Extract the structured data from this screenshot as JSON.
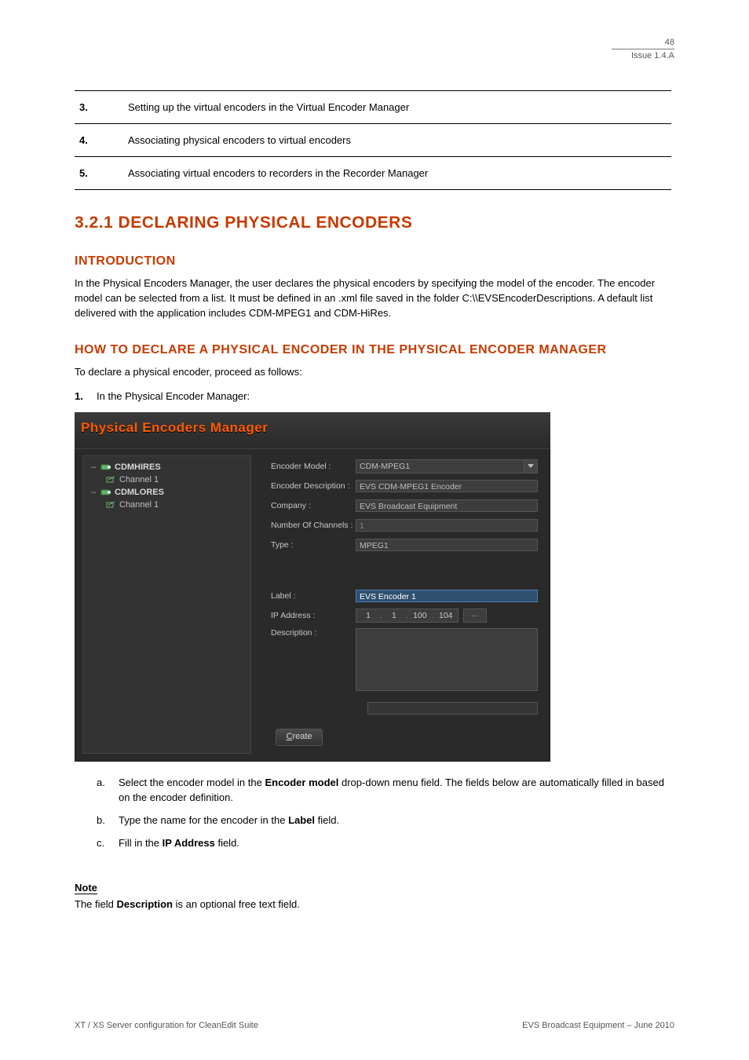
{
  "header": {
    "page_no": "48",
    "issue": "Issue 1.4.A"
  },
  "stage_rows": [
    {
      "n": "3.",
      "t": "Setting up the virtual encoders in the Virtual Encoder Manager"
    },
    {
      "n": "4.",
      "t": "Associating physical encoders to virtual encoders"
    },
    {
      "n": "5.",
      "t": "Associating virtual encoders to recorders in the Recorder Manager"
    }
  ],
  "section": "3.2.1 DECLARING PHYSICAL ENCODERS",
  "intro": {
    "heading": "INTRODUCTION",
    "paragraph": "In the Physical Encoders Manager, the user declares the physical encoders by specifying the model of the encoder. The encoder model can be selected from a list. It must be defined in an .xml file saved in the folder C:\\\\EVSEncoderDescriptions. A default list delivered with the application includes CDM-MPEG1 and CDM-HiRes."
  },
  "howto": {
    "heading": "HOW TO DECLARE A PHYSICAL ENCODER IN THE PHYSICAL ENCODER MANAGER",
    "pre": "To declare a physical encoder, proceed as follows:",
    "step1_n": "1.",
    "step1_t": "In the Physical Encoder Manager:"
  },
  "screenshot": {
    "title": "Physical Encoders Manager",
    "tree": [
      {
        "type": "enc",
        "label": "CDMHIRES"
      },
      {
        "type": "ch",
        "label": "Channel 1"
      },
      {
        "type": "enc",
        "label": "CDMLORES"
      },
      {
        "type": "ch",
        "label": "Channel 1"
      }
    ],
    "form": {
      "rows": [
        {
          "label": "Encoder Model :",
          "kind": "select",
          "value": "CDM-MPEG1"
        },
        {
          "label": "Encoder Description :",
          "kind": "input",
          "value": "EVS CDM-MPEG1 Encoder"
        },
        {
          "label": "Company :",
          "kind": "input",
          "value": "EVS Broadcast Equipment"
        },
        {
          "label": "Number Of Channels :",
          "kind": "input",
          "value": "1",
          "readonly": true
        },
        {
          "label": "Type :",
          "kind": "input",
          "value": "MPEG1"
        }
      ],
      "label_label": "Label :",
      "label_value": "EVS Encoder 1",
      "ip_label": "IP Address :",
      "ip": [
        "1",
        "1",
        "100",
        "104"
      ],
      "ip_btn": "...",
      "desc_label": "Description :",
      "create_label": "Create",
      "create_u": "C",
      "create_rest": "reate"
    }
  },
  "post_steps": [
    {
      "n": "a.",
      "t_prefix": "Select the encoder model in the ",
      "bold": "Encoder model",
      "t_suffix": " drop-down menu field. The fields below are automatically filled in based on the encoder definition."
    },
    {
      "n": "b.",
      "t_prefix": "Type the name for the encoder in the ",
      "bold": "Label",
      "t_suffix": " field."
    },
    {
      "n": "c.",
      "t_prefix": "Fill in the ",
      "bold": "IP Address",
      "t_suffix": " field."
    }
  ],
  "note": {
    "title": "Note",
    "body_pre": "The field ",
    "body_bold": "Description",
    "body_post": " is an optional free text field."
  },
  "footer": {
    "left": "XT / XS Server configuration for CleanEdit Suite",
    "right": "EVS Broadcast Equipment – June 2010"
  }
}
